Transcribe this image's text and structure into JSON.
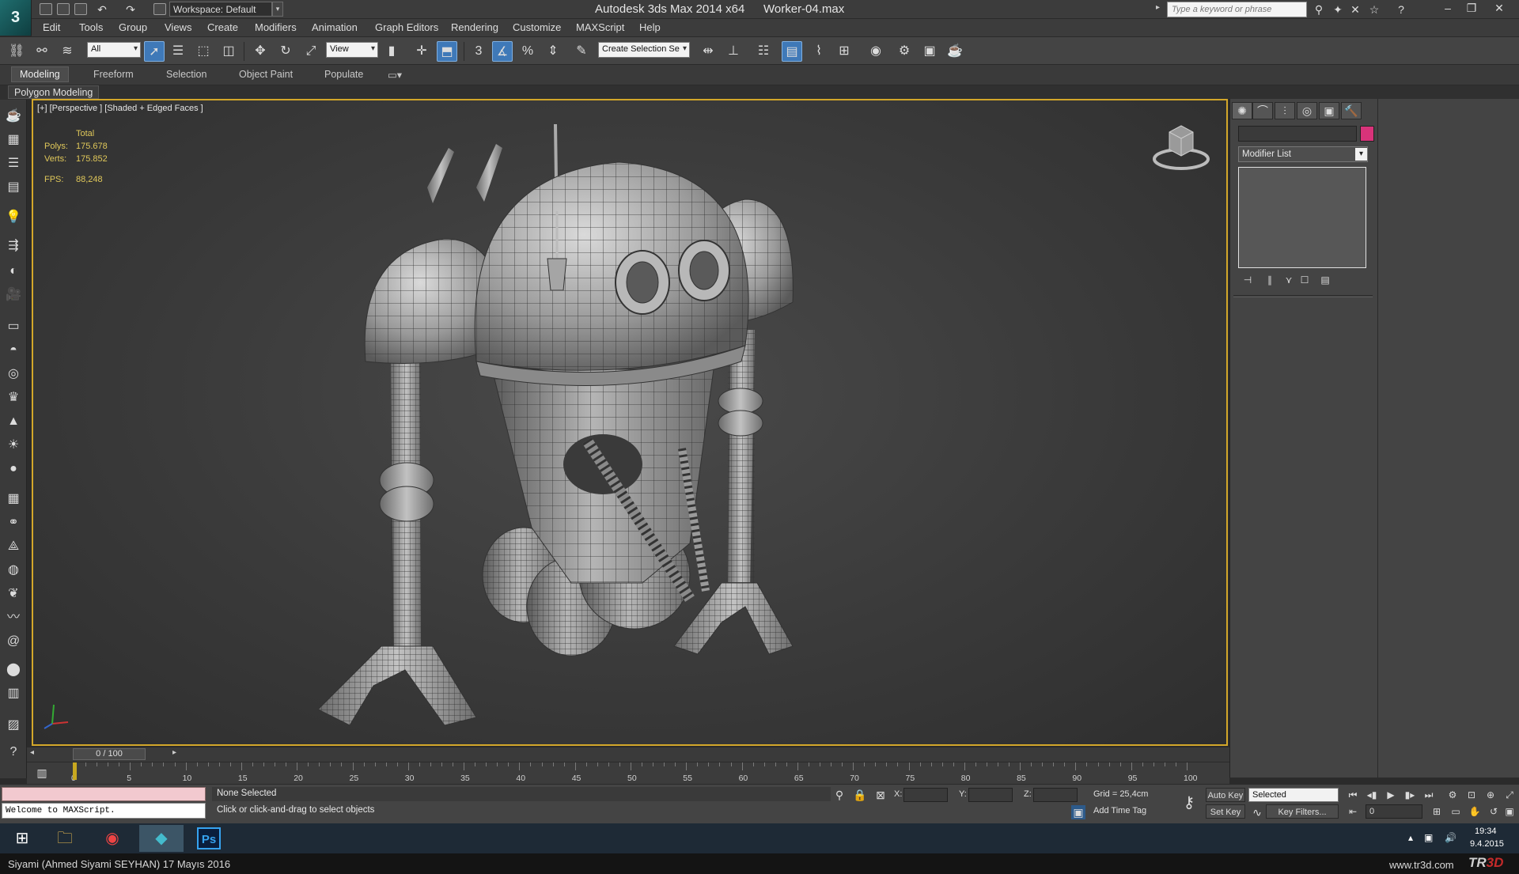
{
  "titlebar": {
    "workspace": "Workspace: Default",
    "app_title": "Autodesk 3ds Max  2014 x64",
    "file_name": "Worker-04.max",
    "search_placeholder": "Type a keyword or phrase"
  },
  "menu": [
    "Edit",
    "Tools",
    "Group",
    "Views",
    "Create",
    "Modifiers",
    "Animation",
    "Graph Editors",
    "Rendering",
    "Customize",
    "MAXScript",
    "Help"
  ],
  "toolbar": {
    "selection_filter": "All",
    "reference_coord": "View",
    "named_selection": "Create Selection Se"
  },
  "ribbon": {
    "tabs": [
      "Modeling",
      "Freeform",
      "Selection",
      "Object Paint",
      "Populate"
    ],
    "active_tab": "Modeling",
    "sub_label": "Polygon Modeling"
  },
  "viewport": {
    "label": "[+] [Perspective ] [Shaded + Edged Faces ]",
    "stats_header": "Total",
    "polys_label": "Polys:",
    "polys_value": "175.678",
    "verts_label": "Verts:",
    "verts_value": "175.852",
    "fps_label": "FPS:",
    "fps_value": "88,248",
    "border_color": "#d3a72a"
  },
  "command_panel": {
    "modifier_list": "Modifier List",
    "object_color": "#d8337a"
  },
  "time": {
    "slider": "0 / 100",
    "ticks": [
      "0",
      "5",
      "10",
      "15",
      "20",
      "25",
      "30",
      "35",
      "40",
      "45",
      "50",
      "55",
      "60",
      "65",
      "70",
      "75",
      "80",
      "85",
      "90",
      "95",
      "100"
    ]
  },
  "status": {
    "listener": "Welcome to MAXScript.",
    "selection": "None Selected",
    "hint": "Click or click-and-drag to select objects",
    "x_label": "X:",
    "y_label": "Y:",
    "z_label": "Z:",
    "grid": "Grid = 25,4cm",
    "add_time_tag": "Add Time Tag",
    "auto_key": "Auto Key",
    "set_key": "Set Key",
    "selected_mode": "Selected",
    "key_filters": "Key Filters...",
    "frame": "0"
  },
  "taskbar": {
    "time": "19:34",
    "date": "9.4.2015",
    "ps_label": "Ps"
  },
  "credit": {
    "author": "Siyami (Ahmed Siyami SEYHAN)  17 Mayıs 2016",
    "site": "www.tr3d.com",
    "logo_text": "TR",
    "logo_accent": "3D"
  }
}
